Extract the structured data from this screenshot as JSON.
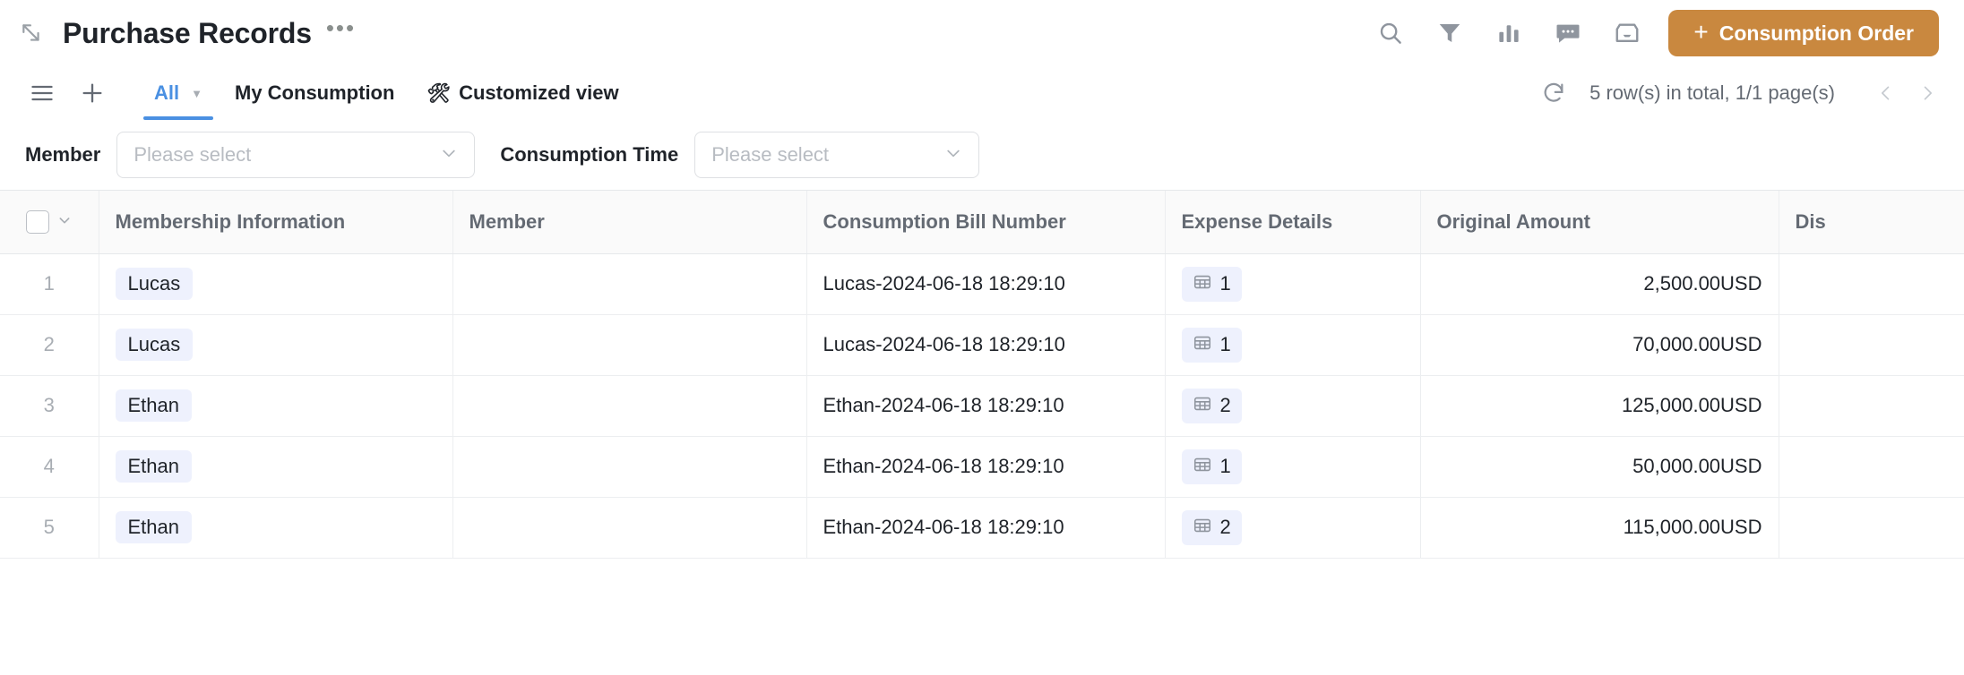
{
  "header": {
    "collapse_icon": "collapse-arrow-icon",
    "title": "Purchase Records",
    "more_label": "•••",
    "icons": [
      {
        "name": "search-icon",
        "label": "Search"
      },
      {
        "name": "filter-icon",
        "label": "Filter"
      },
      {
        "name": "chart-icon",
        "label": "Statistics"
      },
      {
        "name": "comment-icon",
        "label": "Comments"
      },
      {
        "name": "archive-icon",
        "label": "Archive"
      }
    ],
    "primary_button": {
      "plus": "+",
      "label": "Consumption Order",
      "color": "#c9883f"
    }
  },
  "tabbar": {
    "menu_icon": "list-menu-icon",
    "add_icon": "plus-icon",
    "tabs": [
      {
        "label": "All",
        "active": true,
        "caret": "▼",
        "icon": ""
      },
      {
        "label": "My Consumption",
        "active": false,
        "caret": "",
        "icon": ""
      },
      {
        "label": "Customized view",
        "active": false,
        "caret": "",
        "icon": "🛠"
      }
    ],
    "refresh_icon": "refresh-icon",
    "row_count_text": "5 row(s) in total, 1/1 page(s)",
    "prev_label": "‹",
    "next_label": "›"
  },
  "filters": [
    {
      "label": "Member",
      "placeholder": "Please select",
      "value": "",
      "caret": "⌄"
    },
    {
      "label": "Consumption Time",
      "placeholder": "Please select",
      "value": "",
      "caret": "⌄"
    }
  ],
  "table": {
    "select_all_caret": "⌄",
    "columns": [
      {
        "key": "num",
        "label": ""
      },
      {
        "key": "membership",
        "label": "Membership Information"
      },
      {
        "key": "member",
        "label": "Member"
      },
      {
        "key": "bill",
        "label": "Consumption Bill Number"
      },
      {
        "key": "expense",
        "label": "Expense Details"
      },
      {
        "key": "amount",
        "label": "Original Amount"
      },
      {
        "key": "discount",
        "label": "Dis"
      }
    ],
    "rows": [
      {
        "num": "1",
        "membership": "Lucas",
        "member": "",
        "bill": "Lucas-2024-06-18 18:29:10",
        "expense_count": "1",
        "expense_icon": "table-grid-icon",
        "amount": "2,500.00USD",
        "discount": ""
      },
      {
        "num": "2",
        "membership": "Lucas",
        "member": "",
        "bill": "Lucas-2024-06-18 18:29:10",
        "expense_count": "1",
        "expense_icon": "table-grid-icon",
        "amount": "70,000.00USD",
        "discount": ""
      },
      {
        "num": "3",
        "membership": "Ethan",
        "member": "",
        "bill": "Ethan-2024-06-18 18:29:10",
        "expense_count": "2",
        "expense_icon": "table-grid-icon",
        "amount": "125,000.00USD",
        "discount": ""
      },
      {
        "num": "4",
        "membership": "Ethan",
        "member": "",
        "bill": "Ethan-2024-06-18 18:29:10",
        "expense_count": "1",
        "expense_icon": "table-grid-icon",
        "amount": "50,000.00USD",
        "discount": ""
      },
      {
        "num": "5",
        "membership": "Ethan",
        "member": "",
        "bill": "Ethan-2024-06-18 18:29:10",
        "expense_count": "2",
        "expense_icon": "table-grid-icon",
        "amount": "115,000.00USD",
        "discount": ""
      }
    ]
  },
  "colors": {
    "accent_orange": "#c9883f",
    "accent_blue": "#4a90e2",
    "tag_bg": "#eef1fd",
    "header_bg": "#fafafa",
    "border": "#eceef0"
  }
}
